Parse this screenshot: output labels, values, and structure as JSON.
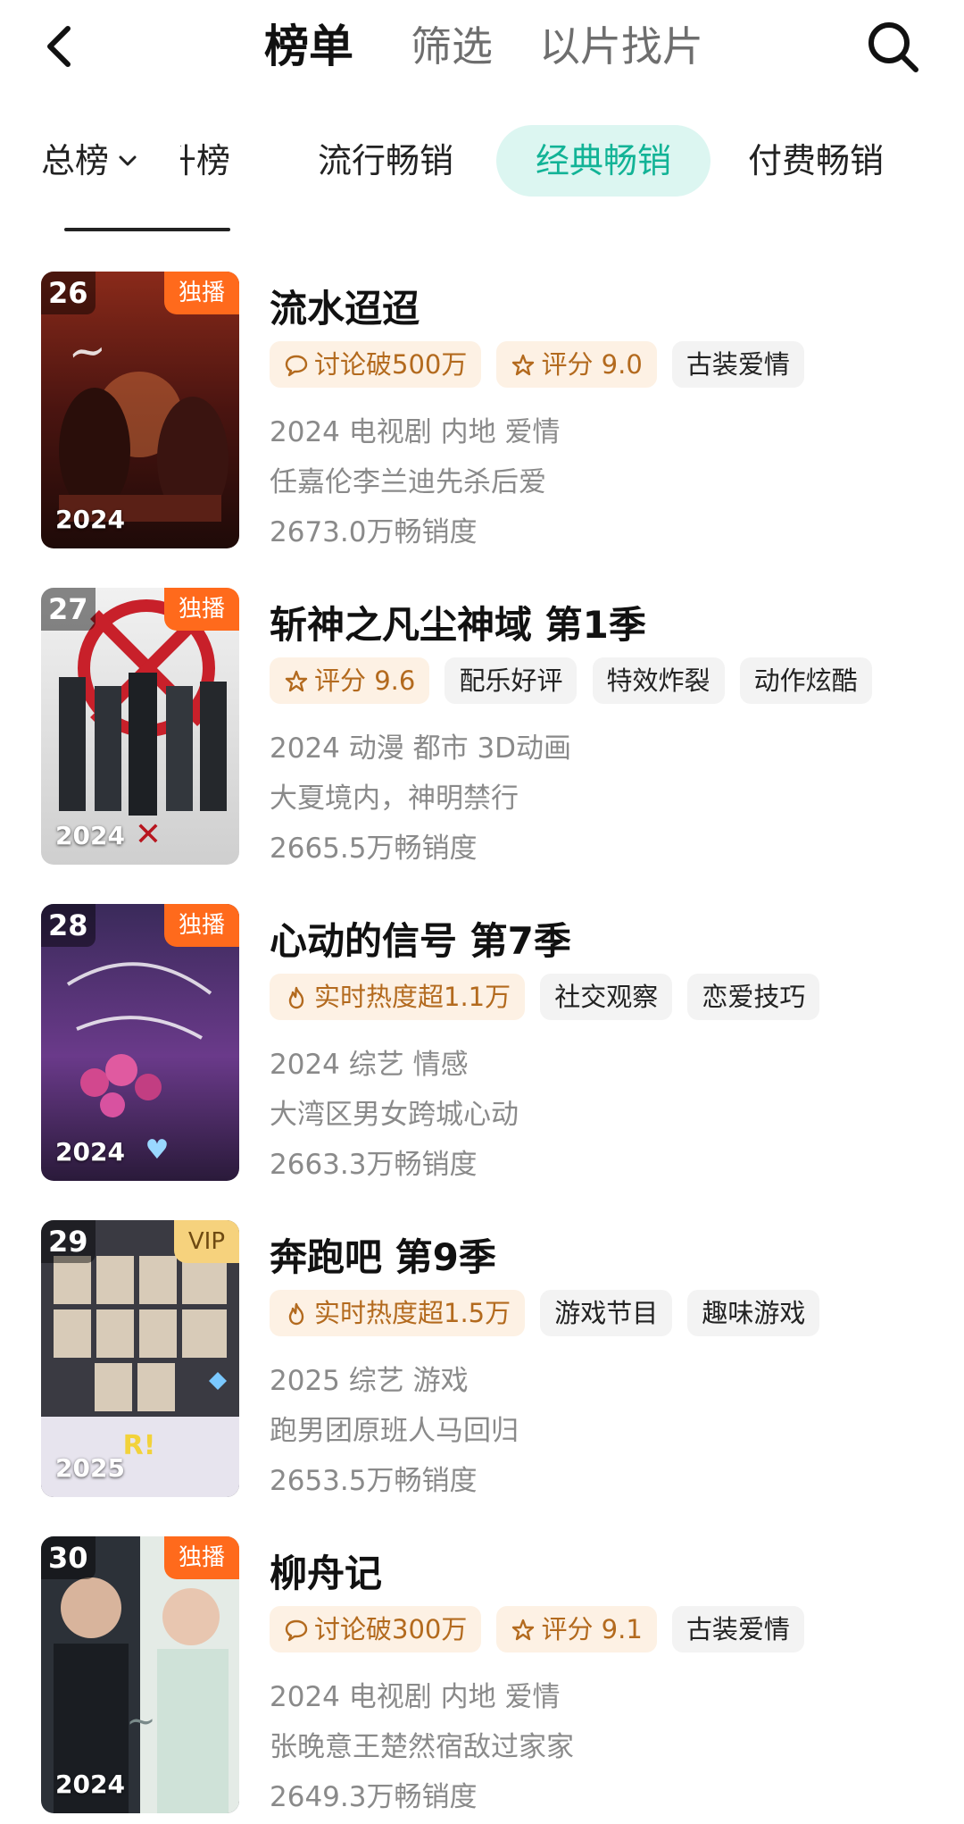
{
  "header": {
    "tabs": [
      "榜单",
      "筛选",
      "以片找片"
    ]
  },
  "subtabs": {
    "dropdown": "总榜",
    "partial": "升榜",
    "items": [
      "流行畅销",
      "经典畅销",
      "付费畅销"
    ],
    "active": "经典畅销"
  },
  "colors": {
    "accent": "#12b396",
    "accent_bg": "#dcf6f1",
    "exclusive_badge": "#ff6a1c",
    "vip_badge": "#f6d27d",
    "warm_chip": "#b36a1e"
  },
  "items": [
    {
      "rank": "26",
      "badge": "独播",
      "poster_year": "2024",
      "title": "流水迢迢",
      "chips": [
        {
          "icon": "comment-icon",
          "text": "讨论破500万",
          "style": "warm"
        },
        {
          "icon": "star-icon",
          "text": "评分 9.0",
          "style": "warm"
        },
        {
          "text": "古装爱情",
          "style": "plain"
        }
      ],
      "meta1": "2024 电视剧 内地 爱情",
      "meta2": "任嘉伦李兰迪先杀后爱",
      "meta3": "2673.0万畅销度"
    },
    {
      "rank": "27",
      "badge": "独播",
      "poster_year": "2024",
      "title": "斩神之凡尘神域 第1季",
      "chips": [
        {
          "icon": "star-icon",
          "text": "评分 9.6",
          "style": "warm"
        },
        {
          "text": "配乐好评",
          "style": "plain"
        },
        {
          "text": "特效炸裂",
          "style": "plain"
        },
        {
          "text": "动作炫酷",
          "style": "plain"
        }
      ],
      "meta1": "2024 动漫 都市 3D动画",
      "meta2": "大夏境内，神明禁行",
      "meta3": "2665.5万畅销度"
    },
    {
      "rank": "28",
      "badge": "独播",
      "poster_year": "2024",
      "title": "心动的信号 第7季",
      "chips": [
        {
          "icon": "flame-icon",
          "text": "实时热度超1.1万",
          "style": "warm"
        },
        {
          "text": "社交观察",
          "style": "plain"
        },
        {
          "text": "恋爱技巧",
          "style": "plain"
        }
      ],
      "meta1": "2024 综艺 情感",
      "meta2": "大湾区男女跨城心动",
      "meta3": "2663.3万畅销度"
    },
    {
      "rank": "29",
      "badge": "VIP",
      "poster_year": "2025",
      "title": "奔跑吧 第9季",
      "chips": [
        {
          "icon": "flame-icon",
          "text": "实时热度超1.5万",
          "style": "warm"
        },
        {
          "text": "游戏节目",
          "style": "plain"
        },
        {
          "text": "趣味游戏",
          "style": "plain"
        }
      ],
      "meta1": "2025 综艺 游戏",
      "meta2": "跑男团原班人马回归",
      "meta3": "2653.5万畅销度"
    },
    {
      "rank": "30",
      "badge": "独播",
      "poster_year": "2024",
      "title": "柳舟记",
      "chips": [
        {
          "icon": "comment-icon",
          "text": "讨论破300万",
          "style": "warm"
        },
        {
          "icon": "star-icon",
          "text": "评分 9.1",
          "style": "warm"
        },
        {
          "text": "古装爱情",
          "style": "plain"
        }
      ],
      "meta1": "2024 电视剧 内地 爱情",
      "meta2": "张晚意王楚然宿敌过家家",
      "meta3": "2649.3万畅销度"
    }
  ]
}
